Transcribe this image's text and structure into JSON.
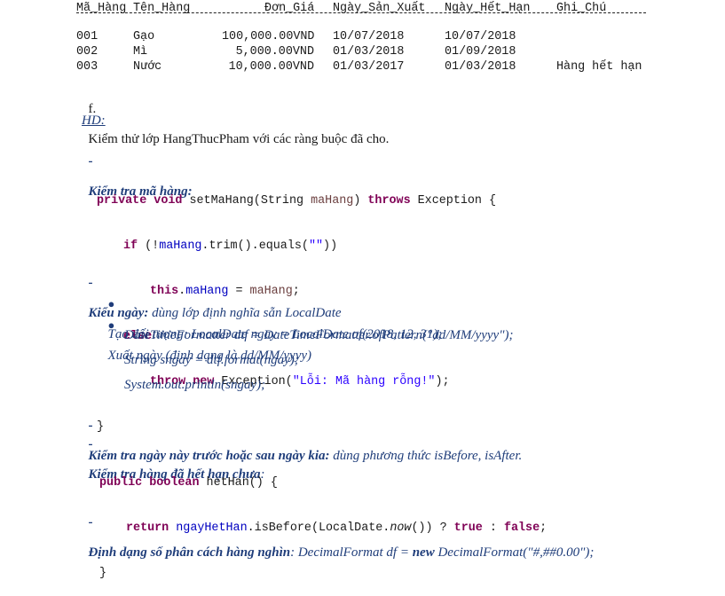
{
  "table": {
    "headers": [
      "Mã_Hàng",
      "Tên_Hàng",
      "Đơn_Giá",
      "Ngày_Sản_Xuất",
      "Ngày_Hết_Hạn",
      "Ghi_Chú"
    ],
    "rows": [
      [
        "001",
        "Gạo",
        "100,000.00VND",
        "10/07/2018",
        "10/07/2018",
        ""
      ],
      [
        "002",
        "Mì",
        "5,000.00VND",
        "01/03/2018",
        "01/09/2018",
        ""
      ],
      [
        "003",
        "Nước",
        "10,000.00VND",
        "01/03/2017",
        "01/03/2018",
        "Hàng hết hạn"
      ]
    ]
  },
  "task": {
    "marker": "f.",
    "text": "Kiểm thử lớp HangThucPham với các ràng buộc đã cho."
  },
  "hd_label": "HD:",
  "sections": {
    "check_code": {
      "dash": "-",
      "title": "Kiểm tra mã hàng:",
      "code": {
        "l1_kw1": "private void",
        "l1_rest": " setMaHang(String ",
        "l1_param": "maHang",
        "l1_rest2": ") ",
        "l1_kw2": "throws",
        "l1_rest3": " Exception {",
        "l2_kw": "if",
        "l2_pre": " (!",
        "l2_fld": "maHang",
        "l2_rest": ".trim().equals(",
        "l2_str": "\"\"",
        "l2_end": "))",
        "l3_kw": "this",
        "l3_dot": ".",
        "l3_fld": "maHang",
        "l3_rest": " = ",
        "l3_param": "maHang",
        "l3_end": ";",
        "l4_kw": "else",
        "l5_kw": "throw new",
        "l5_rest": " Exception(",
        "l5_str": "\"Lỗi: Mã hàng rỗng!\"",
        "l5_end": ");",
        "l6": "}"
      }
    },
    "date_type": {
      "dash": "-",
      "title": "Kiểu ngày:",
      "desc": " dùng lớp định nghĩa sẵn LocalDate",
      "bullets": [
        "Tạo đối tượng: LocalDate ngay = LocalDate.of(2018, 12, 31);",
        "Xuất ngày (định dạng là dd/MM/yyyy)"
      ],
      "lines": [
        "DateTimeFormatter dtf = DateTimeFormatter.ofPattern(\"dd/MM/yyyy\");",
        "String sngay = dtf.format(ngay);",
        "System.out.println(sngay);"
      ]
    },
    "before_after": {
      "dash": "-",
      "title": "Kiểm tra ngày này trước hoặc sau ngày kia:",
      "desc": " dùng phương thức isBefore, isAfter."
    },
    "expired": {
      "dash": "-",
      "title": "Kiểm tra hàng đã hết hạn chưa",
      "colon": ":",
      "code": {
        "l1_kw": "public boolean",
        "l1_rest": " hetHan() {",
        "l2_kw": "return",
        "l2_fld": " ngayHetHan",
        "l2_rest": ".isBefore(LocalDate.",
        "l2_now": "now",
        "l2_rest2": "()) ? ",
        "l2_true": "true",
        "l2_colon": " : ",
        "l2_false": "false",
        "l2_end": ";",
        "l3": "}"
      }
    },
    "thousands": {
      "dash": "-",
      "title": "Định dạng số phân cách hàng nghìn",
      "desc_pre": ": DecimalFormat df = ",
      "desc_kw": "new",
      "desc_post": " DecimalFormat(\"#,##0.00\");"
    }
  }
}
